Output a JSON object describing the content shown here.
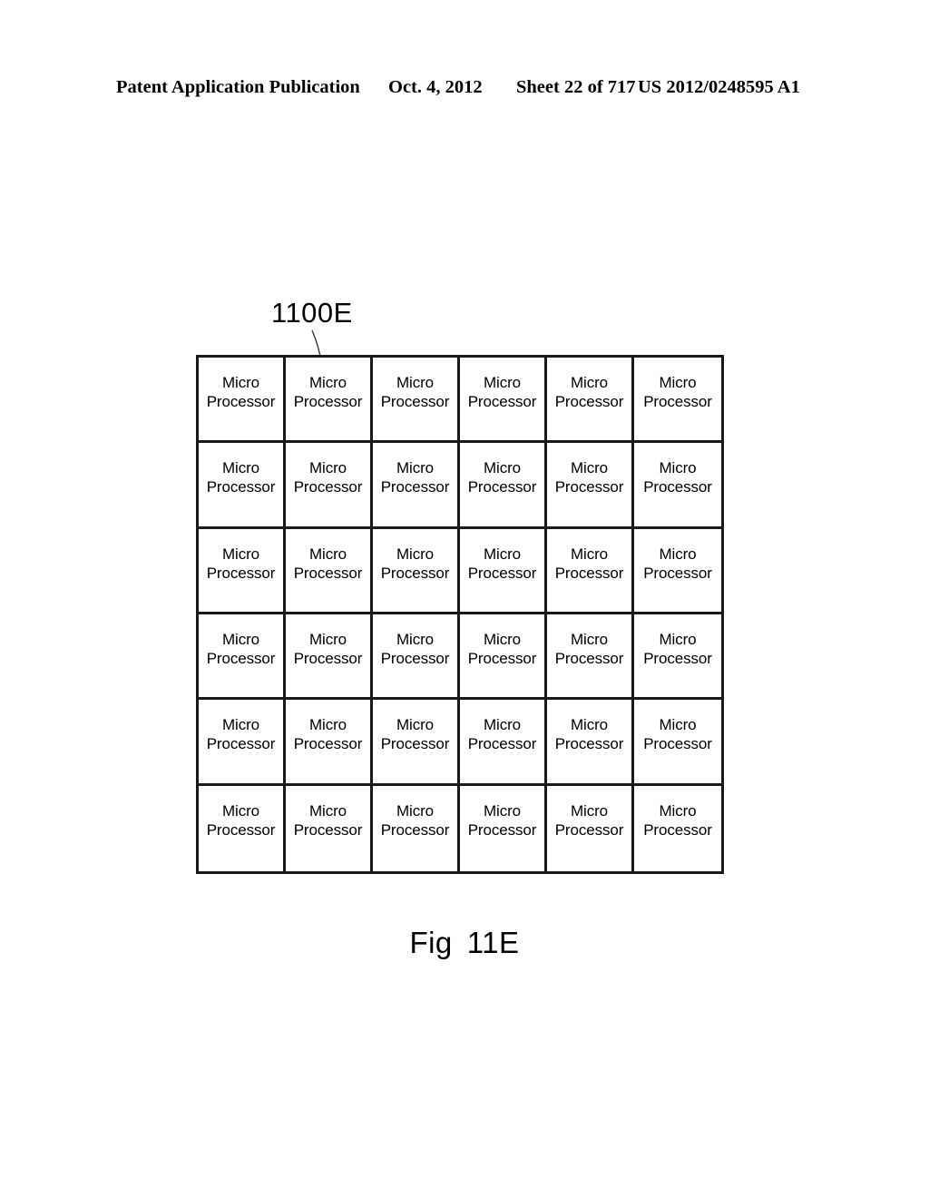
{
  "header": {
    "publication": "Patent Application Publication",
    "date": "Oct. 4, 2012",
    "sheet": "Sheet 22 of 717",
    "patent_number": "US 2012/0248595 A1"
  },
  "figure": {
    "reference_label": "1100E",
    "caption_prefix": "Fig",
    "caption_number": "11E",
    "leader_line": "curved-leader-line"
  },
  "grid": {
    "rows": 6,
    "columns": 6,
    "total_cells": 36,
    "cell_label_line1": "Micro",
    "cell_label_line2": "Processor",
    "border_color": "#1a1a1a",
    "background_color": "#ffffff"
  }
}
